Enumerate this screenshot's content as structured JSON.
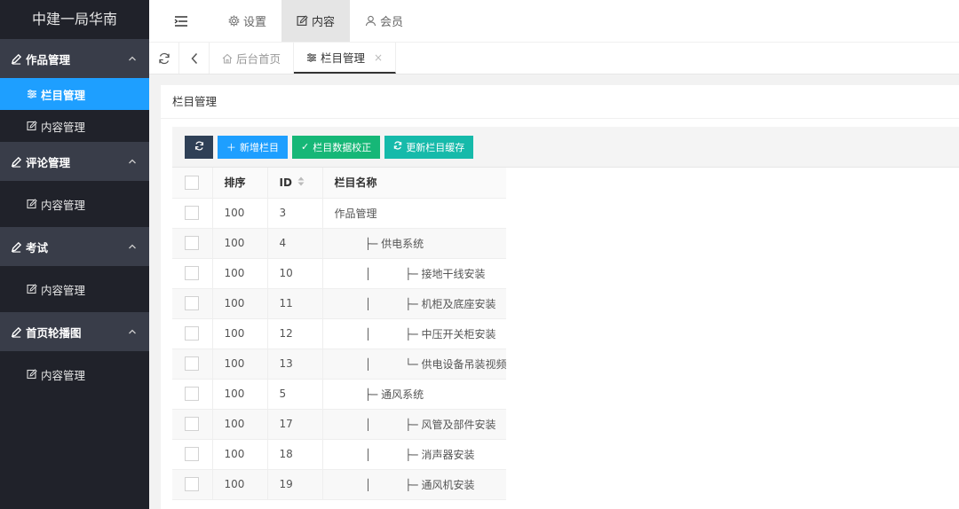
{
  "app": {
    "title": "中建一局华南"
  },
  "sidebar": {
    "groups": [
      {
        "label": "作品管理",
        "items": [
          {
            "label": "栏目管理",
            "active": true
          },
          {
            "label": "内容管理"
          }
        ]
      },
      {
        "label": "评论管理",
        "items": [
          {
            "label": "内容管理"
          }
        ]
      },
      {
        "label": "考试",
        "items": [
          {
            "label": "内容管理"
          }
        ]
      },
      {
        "label": "首页轮播图",
        "items": [
          {
            "label": "内容管理"
          }
        ]
      }
    ]
  },
  "header": {
    "nav": [
      {
        "label": "设置",
        "icon": "gear-icon"
      },
      {
        "label": "内容",
        "icon": "edit-icon",
        "active": true
      },
      {
        "label": "会员",
        "icon": "user-icon"
      }
    ]
  },
  "tabs": [
    {
      "label": "后台首页",
      "icon": "home-icon"
    },
    {
      "label": "栏目管理",
      "icon": "sliders-icon",
      "active": true,
      "close": "×"
    }
  ],
  "card": {
    "title": "栏目管理",
    "toolbar": {
      "add_label": "新增栏目",
      "verify_label": "栏目数据校正",
      "cache_label": "更新栏目缓存"
    },
    "columns": {
      "sort": "排序",
      "id": "ID",
      "name": "栏目名称"
    },
    "rows": [
      {
        "sort": "100",
        "id": "3",
        "name": "作品管理"
      },
      {
        "sort": "100",
        "id": "4",
        "name": "         ├─ 供电系统"
      },
      {
        "sort": "100",
        "id": "10",
        "name": "         │          ├─ 接地干线安装"
      },
      {
        "sort": "100",
        "id": "11",
        "name": "         │          ├─ 机柜及底座安装"
      },
      {
        "sort": "100",
        "id": "12",
        "name": "         │          ├─ 中压开关柜安装"
      },
      {
        "sort": "100",
        "id": "13",
        "name": "         │          └─ 供电设备吊装视频"
      },
      {
        "sort": "100",
        "id": "5",
        "name": "         ├─ 通风系统"
      },
      {
        "sort": "100",
        "id": "17",
        "name": "         │          ├─ 风管及部件安装"
      },
      {
        "sort": "100",
        "id": "18",
        "name": "         │          ├─ 消声器安装"
      },
      {
        "sort": "100",
        "id": "19",
        "name": "         │          ├─ 通风机安装"
      }
    ]
  },
  "colors": {
    "accent": "#1e9fff",
    "sidebar_bg": "#20222a",
    "group_bg": "#393d49",
    "green": "#16b777",
    "teal": "#16baaa"
  }
}
